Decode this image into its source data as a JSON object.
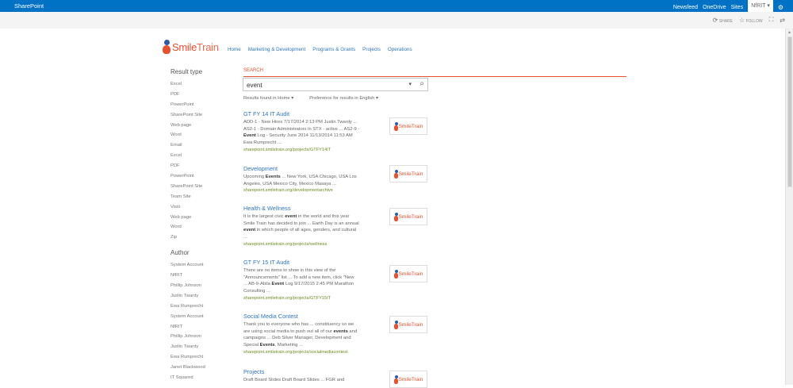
{
  "suitebar": {
    "brand": "SharePoint",
    "links": [
      "Newsfeed",
      "OneDrive",
      "Sites"
    ],
    "user": "NfRIT",
    "user_caret": "▾",
    "gear": "gear-icon"
  },
  "actionbar": {
    "share": "SHARE",
    "follow": "FOLLOW",
    "focus_icon": "focus-icon",
    "sync_icon": "sync-icon"
  },
  "logo": {
    "text_a": "Smile",
    "text_b": "Train"
  },
  "topnav": [
    "Home",
    "Marketing & Development",
    "Programs & Grants",
    "Projects",
    "Operations"
  ],
  "refiners": {
    "result_type_header": "Result type",
    "result_types": [
      "Excel",
      "PDF",
      "PowerPoint",
      "SharePoint Site",
      "Web page",
      "Word",
      "Email",
      "Excel",
      "PDF",
      "PowerPoint",
      "SharePoint Site",
      "Team Site",
      "Visio",
      "Web page",
      "Word",
      "Zip"
    ],
    "author_header": "Author",
    "authors": [
      "System Account",
      "NfRIT",
      "Phillip Johnson",
      "Justin Twardy",
      "Ewa Rumprecht",
      "System Account",
      "NfRIT",
      "Phillip Johnson",
      "Justin Twardy",
      "Ewa Rumprecht",
      "Janet Blackwood",
      "IT Squared"
    ]
  },
  "search": {
    "label": "SEARCH",
    "query": "event",
    "results_found_in": "Results found in Home ▾",
    "preference": "Preference for results in English ▾"
  },
  "results": [
    {
      "title": "GT FY 14 IT Audit",
      "lines": [
        [
          "ADD-1 - New Hires  7/17/2014 2:13 PM Justin Twardy ..."
        ],
        [
          "AS2-1 - Domain Administrators in STX - active ... AS2-9 -"
        ],
        [
          "",
          "Event",
          " Log - Security June 2014  11/13/2014 11:53 AM"
        ],
        [
          "Ewa Rumprecht ..."
        ]
      ],
      "url": "sharepoint.smiletrain.org/projects/GTFY14IT"
    },
    {
      "title": "Development",
      "lines": [
        [
          "Upcoming ",
          "Events",
          " ... New York, USA Chicago, USA Los"
        ],
        [
          "Angeles, USA Mexico City, Mexico Masaya ..."
        ]
      ],
      "url": "sharepoint.smiletrain.org/developmentarchive"
    },
    {
      "title": "Health & Wellness",
      "lines": [
        [
          "It is the largest civic ",
          "event",
          " in the world and this year"
        ],
        [
          "Smile Train has decided to join ... Earth Day is an annual"
        ],
        [
          "",
          "event",
          " in which people of all ages, genders, and cultural"
        ],
        [
          "..."
        ]
      ],
      "url": "sharepoint.smiletrain.org/projects/wellness"
    },
    {
      "title": "GT FY 15 IT Audit",
      "lines": [
        [
          "There are no items to show in this view of the"
        ],
        [
          "\"Announcements\" list ... To add a new item, click \"New"
        ],
        [
          "... AB-9-Abila ",
          "Event",
          " Log  9/17/2015 2:45 PM Marathon"
        ],
        [
          "Consulting ..."
        ]
      ],
      "url": "sharepoint.smiletrain.org/projects/GTFY15IT"
    },
    {
      "title": "Social Media Contest",
      "lines": [
        [
          "Thank you to everyone who has ... constituency so we"
        ],
        [
          "are using social media to push out all of our ",
          "events",
          " and"
        ],
        [
          "campaigns ... Deb Silver Manager, Development and"
        ],
        [
          "Special ",
          "Events",
          ", Marketing ..."
        ]
      ],
      "url": "sharepoint.smiletrain.org/projects/socialmediacontest"
    },
    {
      "title": "Projects",
      "lines": [
        [
          "Draft Board Slides  Draft Board Slides ... FGR and"
        ]
      ],
      "url": ""
    }
  ]
}
